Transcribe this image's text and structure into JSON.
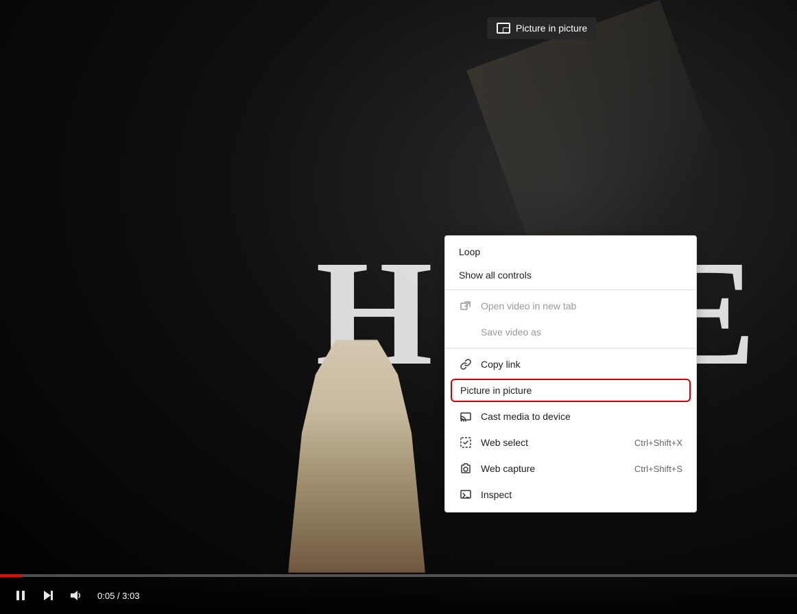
{
  "pip_tooltip": {
    "label": "Picture in picture",
    "icon": "pip-icon"
  },
  "video": {
    "current_time": "0:05",
    "duration": "3:03",
    "progress_percent": 2.7
  },
  "controls": {
    "play_pause_label": "Pause",
    "next_label": "Next",
    "volume_label": "Volume",
    "time_display": "0:05 / 3:03"
  },
  "context_menu": {
    "items": [
      {
        "id": "loop",
        "label": "Loop",
        "icon": null,
        "shortcut": null,
        "disabled": false,
        "separator_after": false
      },
      {
        "id": "show-controls",
        "label": "Show all controls",
        "icon": null,
        "shortcut": null,
        "disabled": false,
        "separator_after": true
      },
      {
        "id": "open-new-tab",
        "label": "Open video in new tab",
        "icon": "external-icon",
        "shortcut": null,
        "disabled": true,
        "separator_after": false
      },
      {
        "id": "save-video",
        "label": "Save video as",
        "icon": null,
        "shortcut": null,
        "disabled": true,
        "separator_after": false
      },
      {
        "id": "copy-link",
        "label": "Copy link",
        "icon": "link-icon",
        "shortcut": null,
        "disabled": false,
        "separator_after": false
      },
      {
        "id": "pip",
        "label": "Picture in picture",
        "icon": null,
        "shortcut": null,
        "disabled": false,
        "highlighted": true,
        "separator_after": false
      },
      {
        "id": "cast",
        "label": "Cast media to device",
        "icon": "cast-icon",
        "shortcut": null,
        "disabled": false,
        "separator_after": false
      },
      {
        "id": "web-select",
        "label": "Web select",
        "icon": "web-select-icon",
        "shortcut": "Ctrl+Shift+X",
        "disabled": false,
        "separator_after": false
      },
      {
        "id": "web-capture",
        "label": "Web capture",
        "icon": "web-capture-icon",
        "shortcut": "Ctrl+Shift+S",
        "disabled": false,
        "separator_after": false
      },
      {
        "id": "inspect",
        "label": "Inspect",
        "icon": "inspect-icon",
        "shortcut": null,
        "disabled": false,
        "separator_after": false
      }
    ]
  },
  "bg_letters": {
    "left": "H",
    "right": "E"
  }
}
